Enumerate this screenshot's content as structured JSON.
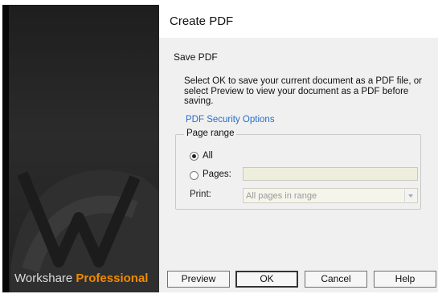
{
  "sidebar": {
    "brand_plain": "Workshare",
    "brand_highlight": "Professional",
    "brand_highlight_color": "#f08a00",
    "logo_icon": "workshare-w-logo"
  },
  "dialog": {
    "title": "Create PDF",
    "section": "Save PDF",
    "description": "Select OK to save your current document as a PDF file, or select Preview to view your document as a PDF before saving.",
    "security_link": "PDF Security Options",
    "link_color": "#2a6dc9",
    "page_range": {
      "legend": "Page range",
      "all_label": "All",
      "pages_label": "Pages:",
      "pages_value": "",
      "selected": "All",
      "print_label": "Print:",
      "print_value": "All pages in range"
    },
    "buttons": {
      "preview": "Preview",
      "ok": "OK",
      "cancel": "Cancel",
      "help": "Help"
    }
  }
}
